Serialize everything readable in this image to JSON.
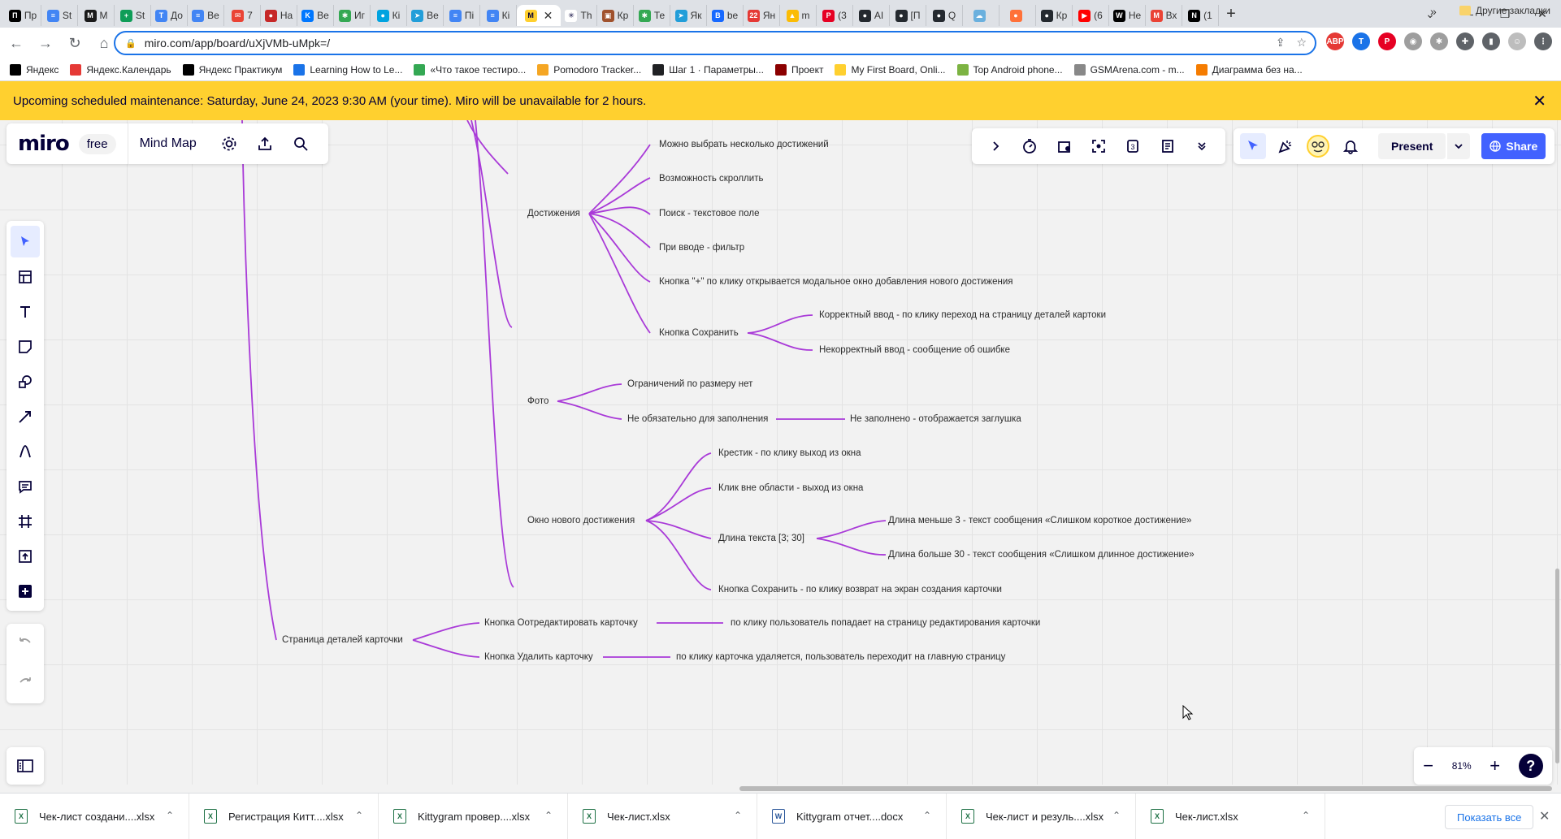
{
  "browser": {
    "tabs": [
      {
        "label": "Пр",
        "color": "#000000",
        "glyph": "П"
      },
      {
        "label": "St",
        "color": "#4285f4",
        "glyph": "≡"
      },
      {
        "label": "M",
        "color": "#1a1a1a",
        "glyph": "M"
      },
      {
        "label": "St",
        "color": "#0f9d58",
        "glyph": "+"
      },
      {
        "label": "До",
        "color": "#4285f4",
        "glyph": "T"
      },
      {
        "label": "Ве",
        "color": "#4285f4",
        "glyph": "≡"
      },
      {
        "label": "7",
        "color": "#ea4335",
        "glyph": "✉"
      },
      {
        "label": "На",
        "color": "#c62828",
        "glyph": "●"
      },
      {
        "label": "Ве",
        "color": "#0077ff",
        "glyph": "K"
      },
      {
        "label": "Иг",
        "color": "#34a853",
        "glyph": "✱"
      },
      {
        "label": "Кі",
        "color": "#00a3e0",
        "glyph": "●"
      },
      {
        "label": "Ве",
        "color": "#229ed9",
        "glyph": "➤"
      },
      {
        "label": "Пі",
        "color": "#4285f4",
        "glyph": "≡"
      },
      {
        "label": "Кі",
        "color": "#4285f4",
        "glyph": "≡"
      },
      {
        "label": "",
        "color": "#ffd02f",
        "glyph": "M",
        "active": true
      },
      {
        "label": "Th",
        "color": "#ffffff",
        "glyph": "✳"
      },
      {
        "label": "Кр",
        "color": "#a0522d",
        "glyph": "▣"
      },
      {
        "label": "Те",
        "color": "#34a853",
        "glyph": "✱"
      },
      {
        "label": "Як",
        "color": "#229ed9",
        "glyph": "➤"
      },
      {
        "label": "be",
        "color": "#1769ff",
        "glyph": "B"
      },
      {
        "label": "Ян",
        "color": "#e53935",
        "glyph": "22"
      },
      {
        "label": "m",
        "color": "#fbbc05",
        "glyph": "▲"
      },
      {
        "label": "(3",
        "color": "#e60023",
        "glyph": "P"
      },
      {
        "label": "АІ",
        "color": "#24292f",
        "glyph": "●"
      },
      {
        "label": "[П",
        "color": "#24292f",
        "glyph": "●"
      },
      {
        "label": "Q",
        "color": "#24292f",
        "glyph": "●"
      },
      {
        "label": "",
        "color": "#6ab0de",
        "glyph": "☁"
      },
      {
        "label": "",
        "color": "#ff7139",
        "glyph": "●"
      },
      {
        "label": "Кр",
        "color": "#24292f",
        "glyph": "●"
      },
      {
        "label": "(6",
        "color": "#ff0000",
        "glyph": "▶"
      },
      {
        "label": "Не",
        "color": "#000000",
        "glyph": "W"
      },
      {
        "label": "Вх",
        "color": "#ea4335",
        "glyph": "M"
      },
      {
        "label": "(1",
        "color": "#000000",
        "glyph": "N"
      }
    ],
    "url": "miro.com/app/board/uXjVMb-uMpk=/",
    "bookmarks": [
      {
        "label": "Яндекс",
        "color": "#000000"
      },
      {
        "label": "Яндекс.Календарь",
        "color": "#e53935"
      },
      {
        "label": "Яндекс Практикум",
        "color": "#000000"
      },
      {
        "label": "Learning How to Le...",
        "color": "#1a73e8"
      },
      {
        "label": "«Что такое тестиро...",
        "color": "#34a853"
      },
      {
        "label": "Pomodoro Tracker...",
        "color": "#f5a623"
      },
      {
        "label": "Шаг 1 · Параметры...",
        "color": "#202124"
      },
      {
        "label": "Проект",
        "color": "#8b0000"
      },
      {
        "label": "My First Board, Onli...",
        "color": "#ffd02f"
      },
      {
        "label": "Top Android phone...",
        "color": "#7cb342"
      },
      {
        "label": "GSMArena.com - m...",
        "color": "#888888"
      },
      {
        "label": "Диаграмма без на...",
        "color": "#f57c00"
      }
    ],
    "bookmarks_more": "»",
    "other_bookmarks": "Другие закладки"
  },
  "banner": {
    "text": "Upcoming scheduled maintenance: Saturday, June 24, 2023 9:30 AM (your time). Miro will be unavailable for 2 hours."
  },
  "miro": {
    "logo": "miro",
    "plan": "free",
    "board_name": "Mind Map",
    "present_label": "Present",
    "share_label": "Share",
    "zoom_level": "81%",
    "help_label": "?",
    "colors": {
      "accent": "#4262ff",
      "branch": "#a93ad8",
      "banner": "#ffd02f"
    }
  },
  "mindmap": {
    "nodes": {
      "n1": "Можно выбрать несколько достижений",
      "n2": "Возможность скроллить",
      "ach": "Достижения",
      "n3": "Поиск - текстовое поле",
      "n4": "При вводе - фильтр",
      "n5": "Кнопка \"+\" по клику открывается модальное окно добавления нового достижения",
      "save": "Кнопка Сохранить",
      "ok": "Корректный ввод - по клику переход на страницу деталей картоки",
      "bad": "Некорректный ввод - сообщение об ошибке",
      "photo": "Фото",
      "p1": "Ограничений по размеру нет",
      "p2": "Не обязательно для заполнения",
      "p3": "Не заполнено - отображается заглушка",
      "win": "Окно нового достижения",
      "w1": "Крестик - по клику выход из окна",
      "w2": "Клик вне области - выход из окна",
      "len": "Длина текста [3; 30]",
      "l1": "Длина меньше 3 - текст сообщения  «Слишком короткое достижение»",
      "l2": "Длина больше 30 - текст сообщения «Слишком длинное достижение»",
      "w3": "Кнопка Сохранить - по клику возврат на экран создания карточки",
      "details": "Страница деталей карточки",
      "edit": "Кнопка Оотредактировать карточку",
      "edit_r": "по клику пользователь попадает на страницу редактирования карточки",
      "del": "Кнопка Удалить карточку",
      "del_r": "по клику карточка удаляется, пользователь переходит на главную страницу"
    }
  },
  "downloads": {
    "items": [
      {
        "name": "Чек-лист создани....xlsx",
        "type": "xlsx"
      },
      {
        "name": "Регистрация Китт....xlsx",
        "type": "xlsx"
      },
      {
        "name": "Kittygram провер....xlsx",
        "type": "xlsx"
      },
      {
        "name": "Чек-лист.xlsx",
        "type": "xlsx"
      },
      {
        "name": "Kittygram отчет....docx",
        "type": "docx"
      },
      {
        "name": "Чек-лист и резуль....xlsx",
        "type": "xlsx"
      },
      {
        "name": "Чек-лист.xlsx",
        "type": "xlsx"
      }
    ],
    "show_all": "Показать все"
  }
}
